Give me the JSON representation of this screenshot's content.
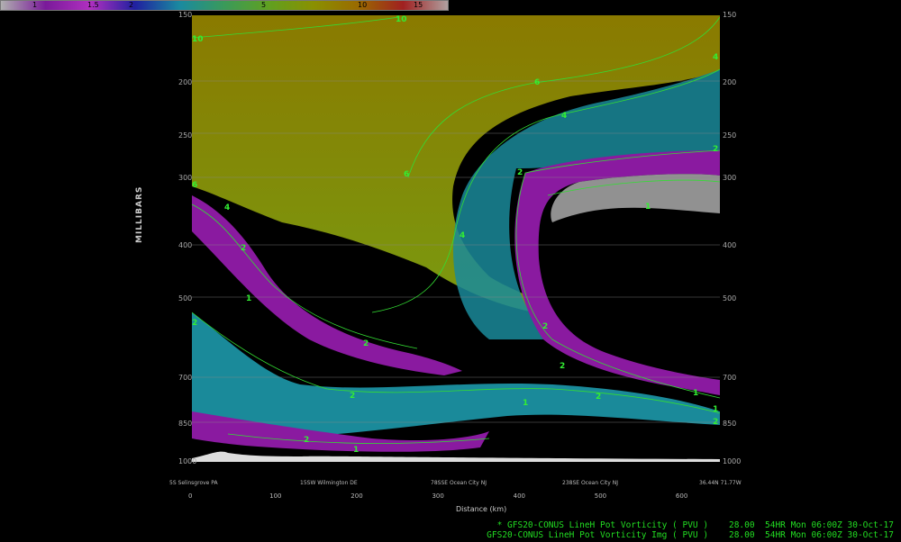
{
  "colorbar": {
    "labels": [
      "1",
      "1.5",
      "2",
      "5",
      "10",
      "15"
    ],
    "colors": [
      "#b0b0b0",
      "#7a1a9a",
      "#b030c0",
      "#2020a0",
      "#1a8aa0",
      "#3a9a5a",
      "#60a020",
      "#8a9000",
      "#9a6a00",
      "#a02020",
      "#b0a0a0"
    ]
  },
  "y_axis": {
    "title": "MILLIBARS",
    "ticks": [
      "150",
      "200",
      "250",
      "300",
      "400",
      "500",
      "700",
      "850",
      "1000"
    ]
  },
  "x_axis": {
    "title": "Distance (km)",
    "ticks": [
      "0",
      "100",
      "200",
      "300",
      "400",
      "500",
      "600"
    ],
    "locations": [
      "5S Selinsgrove PA",
      "15SW Wilmington DE",
      "78SSE Ocean City NJ",
      "238SE Ocean City NJ",
      "36.44N 71.77W"
    ]
  },
  "status_lines": [
    "* GFS20-CONUS LineH Pot Vorticity ( PVU )    28.00  54HR Mon 06:00Z 30-Oct-17",
    "GFS20-CONUS LineH Pot Vorticity Img ( PVU )    28.00  54HR Mon 06:00Z 30-Oct-17"
  ],
  "contour_labels": [
    "10",
    "10",
    "4",
    "6",
    "4",
    "2",
    "6",
    "6",
    "4",
    "4",
    "2",
    "2",
    "1",
    "1",
    "2",
    "2",
    "2",
    "1",
    "2",
    "1",
    "2",
    "2",
    "2",
    "1",
    "2",
    "1"
  ],
  "chart_data": {
    "type": "heatmap",
    "title": "",
    "xlabel": "Distance (km)",
    "ylabel": "MILLIBARS",
    "xlim": [
      0,
      650
    ],
    "ylim": [
      1000,
      150
    ],
    "y_scale": "log",
    "contour_levels": [
      1,
      2,
      4,
      6,
      10
    ],
    "units": "PVU",
    "grid": true
  }
}
